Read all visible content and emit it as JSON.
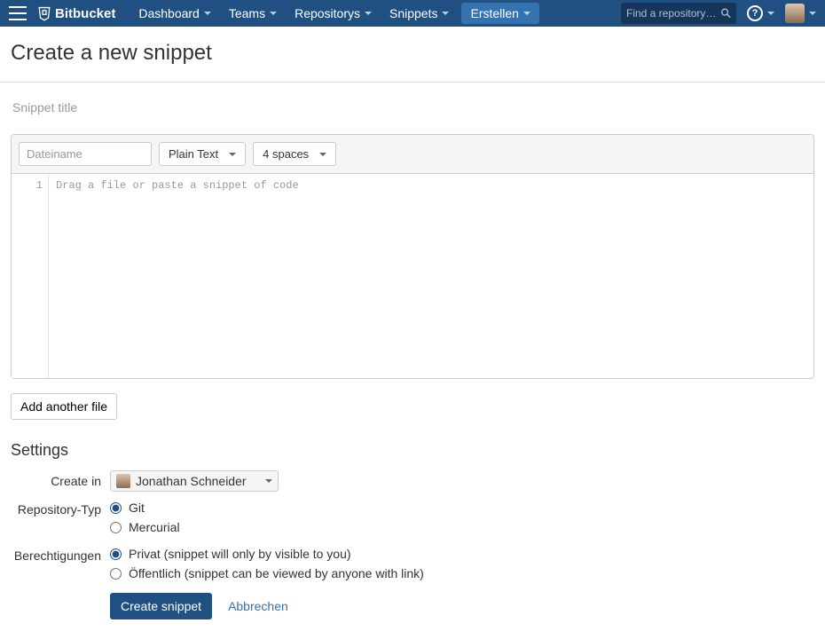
{
  "header": {
    "brand": "Bitbucket",
    "nav": [
      {
        "label": "Dashboard"
      },
      {
        "label": "Teams"
      },
      {
        "label": "Repositorys"
      },
      {
        "label": "Snippets"
      }
    ],
    "create_label": "Erstellen",
    "search_placeholder": "Find a repository…"
  },
  "page": {
    "title": "Create a new snippet",
    "snippet_title_placeholder": "Snippet title"
  },
  "editor": {
    "filename_placeholder": "Dateiname",
    "syntax_label": "Plain Text",
    "indent_label": "4 spaces",
    "line_number": "1",
    "placeholder": "Drag a file or paste a snippet of code"
  },
  "add_file_label": "Add another file",
  "settings": {
    "heading": "Settings",
    "create_in": {
      "label": "Create in",
      "value": "Jonathan Schneider"
    },
    "repo_type": {
      "label": "Repository-Typ",
      "options": [
        "Git",
        "Mercurial"
      ],
      "selected": "Git"
    },
    "permissions": {
      "label": "Berechtigungen",
      "options": [
        "Privat (snippet will only by visible to you)",
        "Öffentlich (snippet can be viewed by anyone with link)"
      ],
      "selected": 0
    },
    "submit_label": "Create snippet",
    "cancel_label": "Abbrechen"
  }
}
